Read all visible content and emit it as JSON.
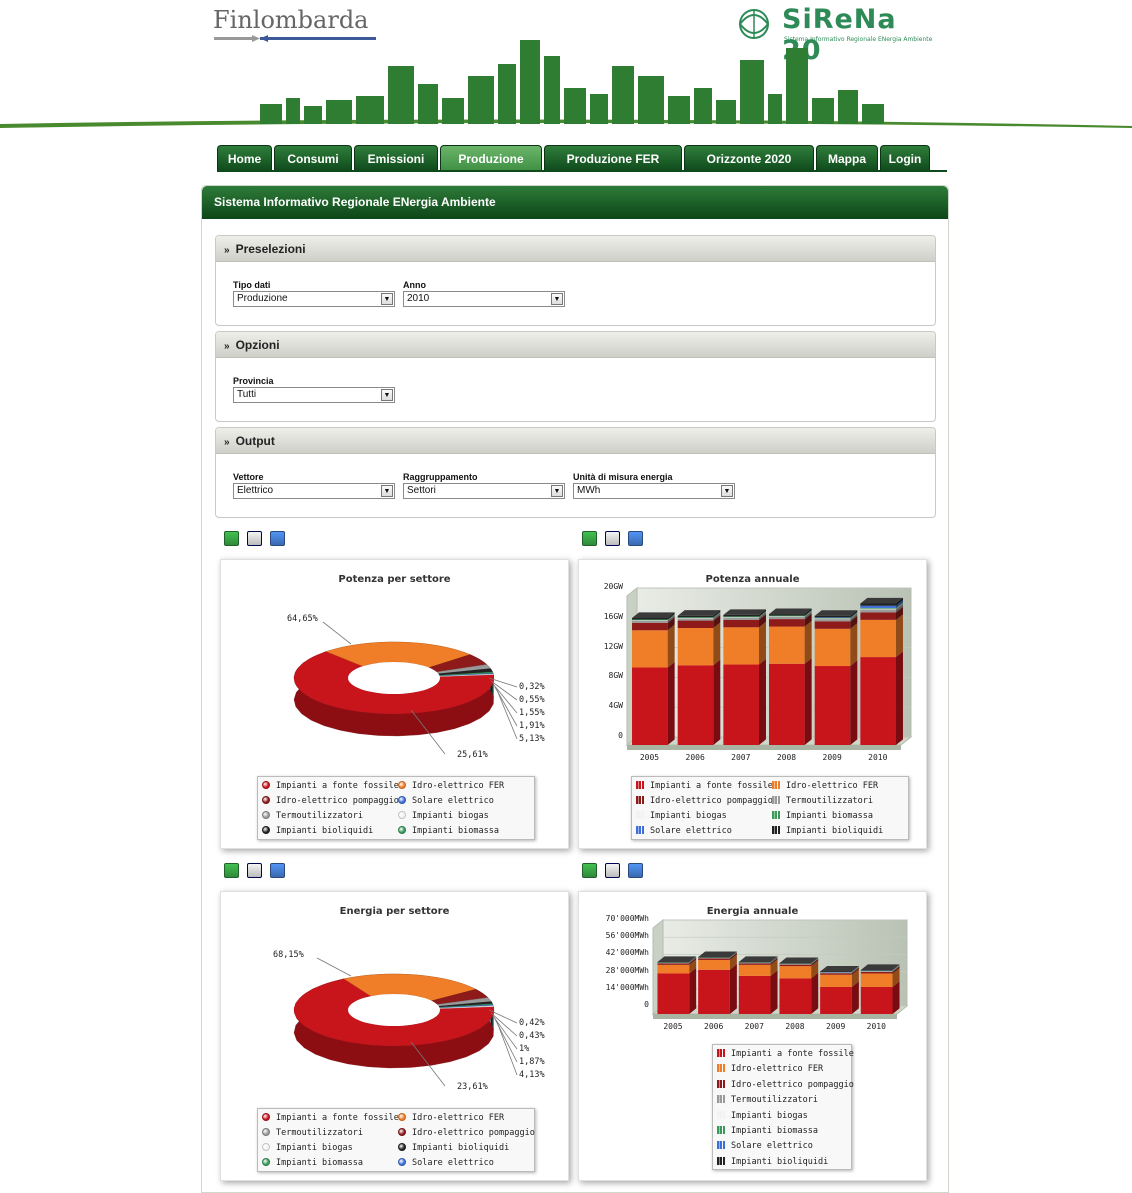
{
  "header": {
    "finlombarda_logo": "Finlombarda",
    "sirena_logo": "SiReNa 20",
    "sirena_subtitle": "Sistema Informativo Regionale ENergia Ambiente"
  },
  "nav": {
    "tabs": [
      {
        "label": "Home",
        "active": false
      },
      {
        "label": "Consumi",
        "active": false
      },
      {
        "label": "Emissioni",
        "active": false
      },
      {
        "label": "Produzione",
        "active": true
      },
      {
        "label": "Produzione FER",
        "active": false
      },
      {
        "label": "Orizzonte 2020",
        "active": false
      },
      {
        "label": "Mappa",
        "active": false
      },
      {
        "label": "Login",
        "active": false
      }
    ]
  },
  "panel": {
    "title": "Sistema Informativo Regionale ENergia Ambiente"
  },
  "preselezioni": {
    "title": "Preselezioni",
    "tipo_dati_label": "Tipo dati",
    "tipo_dati_value": "Produzione",
    "anno_label": "Anno",
    "anno_value": "2010"
  },
  "opzioni": {
    "title": "Opzioni",
    "provincia_label": "Provincia",
    "provincia_value": "Tutti"
  },
  "output": {
    "title": "Output",
    "vettore_label": "Vettore",
    "vettore_value": "Elettrico",
    "raggruppamento_label": "Raggruppamento",
    "raggruppamento_value": "Settori",
    "unita_label": "Unità di misura energia",
    "unita_value": "MWh"
  },
  "toolbar_icons": [
    "excel-export-icon",
    "print-icon",
    "save-image-icon"
  ],
  "colors": {
    "fossile": "#c8141b",
    "idro_fer": "#f07d28",
    "pompaggio": "#8e1a1a",
    "termo": "#9a9a9a",
    "biogas": "#f2f2f2",
    "biomassa": "#3a9a5a",
    "solare": "#3d6fd8",
    "bioliquidi": "#222222",
    "header_green": "#0f4a1c"
  },
  "chart_data": [
    {
      "type": "pie",
      "title": "Potenza per settore",
      "slices": [
        {
          "name": "Impianti a fonte fossile",
          "value": 64.65,
          "label": "64,65%"
        },
        {
          "name": "Idro-elettrico FER",
          "value": 25.61,
          "label": "25,61%"
        },
        {
          "name": "Idro-elettrico pompaggio",
          "value": 5.13,
          "label": "5,13%"
        },
        {
          "name": "Termoutilizzatori",
          "value": 1.91,
          "label": "1,91%"
        },
        {
          "name": "Impianti bioliquidi",
          "value": 1.55,
          "label": "1,55%"
        },
        {
          "name": "Impianti biomassa",
          "value": 0.55,
          "label": "0,55%"
        },
        {
          "name": "Solare elettrico",
          "value": 0.32,
          "label": "0,32%"
        },
        {
          "name": "Impianti biogas",
          "value": 0.28,
          "label": ""
        }
      ],
      "legend": [
        "Impianti a fonte fossile",
        "Idro-elettrico FER",
        "Idro-elettrico pompaggio",
        "Solare elettrico",
        "Termoutilizzatori",
        "Impianti biogas",
        "Impianti bioliquidi",
        "Impianti biomassa"
      ],
      "legend_keys": [
        "fossile",
        "idro_fer",
        "pompaggio",
        "solare",
        "termo",
        "biogas",
        "bioliquidi",
        "biomassa"
      ]
    },
    {
      "type": "bar",
      "stacked": true,
      "title": "Potenza annuale",
      "categories": [
        "2005",
        "2006",
        "2007",
        "2008",
        "2009",
        "2010"
      ],
      "ylim": [
        0,
        20
      ],
      "yticks": [
        "0",
        "4GW",
        "8GW",
        "12GW",
        "16GW",
        "20GW"
      ],
      "ytick_values": [
        0,
        4,
        8,
        12,
        16,
        20
      ],
      "series": [
        {
          "name": "Impianti a fonte fossile",
          "key": "fossile",
          "values": [
            10.4,
            10.7,
            10.8,
            10.9,
            10.6,
            11.8
          ]
        },
        {
          "name": "Idro-elettrico FER",
          "key": "idro_fer",
          "values": [
            5.0,
            5.0,
            5.0,
            5.0,
            5.0,
            5.0
          ]
        },
        {
          "name": "Idro-elettrico pompaggio",
          "key": "pompaggio",
          "values": [
            1.0,
            1.0,
            1.0,
            1.0,
            1.0,
            1.0
          ]
        },
        {
          "name": "Termoutilizzatori",
          "key": "termo",
          "values": [
            0.3,
            0.3,
            0.3,
            0.3,
            0.3,
            0.4
          ]
        },
        {
          "name": "Impianti biogas",
          "key": "biogas",
          "values": [
            0.05,
            0.05,
            0.06,
            0.07,
            0.08,
            0.1
          ]
        },
        {
          "name": "Impianti biomassa",
          "key": "biomassa",
          "values": [
            0.1,
            0.1,
            0.1,
            0.1,
            0.1,
            0.1
          ]
        },
        {
          "name": "Solare elettrico",
          "key": "solare",
          "values": [
            0,
            0,
            0,
            0,
            0.05,
            0.3
          ]
        },
        {
          "name": "Impianti bioliquidi",
          "key": "bioliquidi",
          "values": [
            0.2,
            0.2,
            0.2,
            0.2,
            0.2,
            0.3
          ]
        }
      ],
      "legend": [
        "Impianti a fonte fossile",
        "Idro-elettrico FER",
        "Idro-elettrico pompaggio",
        "Termoutilizzatori",
        "Impianti biogas",
        "Impianti biomassa",
        "Solare elettrico",
        "Impianti bioliquidi"
      ]
    },
    {
      "type": "pie",
      "title": "Energia per settore",
      "slices": [
        {
          "name": "Impianti a fonte fossile",
          "value": 68.15,
          "label": "68,15%"
        },
        {
          "name": "Idro-elettrico FER",
          "value": 23.61,
          "label": "23,61%"
        },
        {
          "name": "Idro-elettrico pompaggio",
          "value": 4.13,
          "label": "4,13%"
        },
        {
          "name": "Termoutilizzatori",
          "value": 1.87,
          "label": "1,87%"
        },
        {
          "name": "Impianti bioliquidi",
          "value": 1.0,
          "label": "1%"
        },
        {
          "name": "Impianti biomassa",
          "value": 0.43,
          "label": "0,43%"
        },
        {
          "name": "Solare elettrico",
          "value": 0.42,
          "label": "0,42%"
        },
        {
          "name": "Impianti biogas",
          "value": 0.39,
          "label": ""
        }
      ],
      "legend": [
        "Impianti a fonte fossile",
        "Idro-elettrico FER",
        "Termoutilizzatori",
        "Idro-elettrico pompaggio",
        "Impianti biogas",
        "Impianti bioliquidi",
        "Impianti biomassa",
        "Solare elettrico"
      ],
      "legend_keys": [
        "fossile",
        "idro_fer",
        "termo",
        "pompaggio",
        "biogas",
        "bioliquidi",
        "biomassa",
        "solare"
      ]
    },
    {
      "type": "bar",
      "stacked": true,
      "title": "Energia annuale",
      "categories": [
        "2005",
        "2006",
        "2007",
        "2008",
        "2009",
        "2010"
      ],
      "ylim": [
        0,
        70000
      ],
      "yticks": [
        "0",
        "14'000MWh",
        "28'000MWh",
        "42'000MWh",
        "56'000MWh",
        "70'000MWh"
      ],
      "ytick_values": [
        0,
        14000,
        28000,
        42000,
        56000,
        70000
      ],
      "series": [
        {
          "name": "Impianti a fonte fossile",
          "key": "fossile",
          "values": [
            33000,
            36000,
            31000,
            29000,
            22000,
            22000
          ]
        },
        {
          "name": "Idro-elettrico FER",
          "key": "idro_fer",
          "values": [
            7000,
            8000,
            9000,
            10000,
            10000,
            11000
          ]
        },
        {
          "name": "Idro-elettrico pompaggio",
          "key": "pompaggio",
          "values": [
            1200,
            1200,
            1200,
            1200,
            1200,
            1200
          ]
        },
        {
          "name": "Termoutilizzatori",
          "key": "termo",
          "values": [
            600,
            600,
            600,
            600,
            600,
            700
          ]
        },
        {
          "name": "Impianti biogas",
          "key": "biogas",
          "values": [
            100,
            100,
            150,
            200,
            300,
            400
          ]
        },
        {
          "name": "Impianti biomassa",
          "key": "biomassa",
          "values": [
            200,
            200,
            200,
            200,
            200,
            200
          ]
        },
        {
          "name": "Solare elettrico",
          "key": "solare",
          "values": [
            0,
            0,
            0,
            0,
            50,
            150
          ]
        },
        {
          "name": "Impianti bioliquidi",
          "key": "bioliquidi",
          "values": [
            200,
            200,
            200,
            200,
            200,
            200
          ]
        }
      ],
      "legend": [
        "Impianti a fonte fossile",
        "Idro-elettrico FER",
        "Idro-elettrico pompaggio",
        "Termoutilizzatori",
        "Impianti biogas",
        "Impianti biomassa",
        "Solare elettrico",
        "Impianti bioliquidi"
      ]
    }
  ]
}
